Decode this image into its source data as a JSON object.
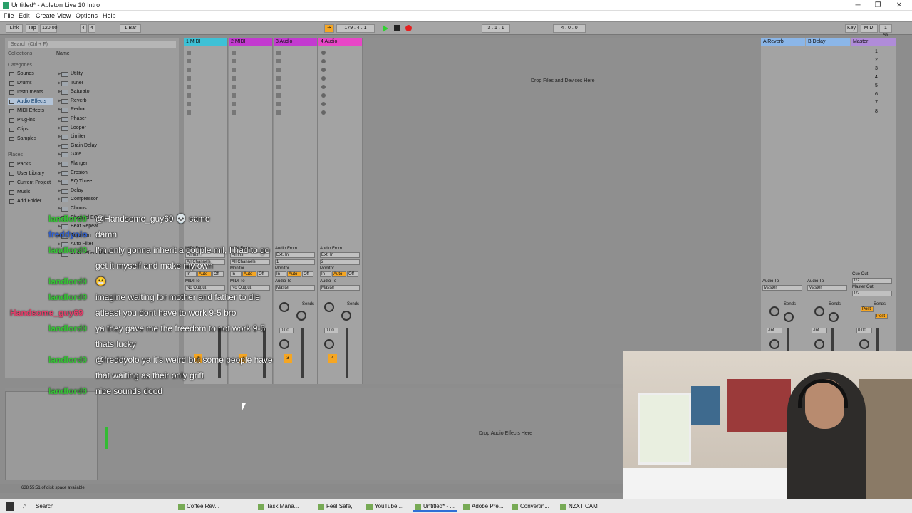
{
  "window": {
    "title": "Untitled* - Ableton Live 10 Intro",
    "min": "─",
    "max": "❐",
    "close": "✕"
  },
  "menu": [
    "File",
    "Edit",
    "Create",
    "View",
    "Options",
    "Help"
  ],
  "transport": {
    "link": "Link",
    "tap": "Tap",
    "tempo": "120.00",
    "sig_num": "4",
    "sig_den": "4",
    "quant": "1 Bar",
    "position": "179 . 4 . 1",
    "loop_start": "3 . 1 . 1",
    "loop_len": "4 . 0 . 0",
    "key": "Key",
    "midi": "MIDI",
    "cpu": "1 %",
    "play_color": "#2fd12f",
    "rec_color": "#e52020"
  },
  "browser": {
    "search_placeholder": "Search (Ctrl + F)",
    "collections": "Collections",
    "categories_label": "Categories",
    "categories": [
      "Sounds",
      "Drums",
      "Instruments",
      "Audio Effects",
      "MIDI Effects",
      "Plug-ins",
      "Clips",
      "Samples"
    ],
    "selected_category": "Audio Effects",
    "places_label": "Places",
    "places": [
      "Packs",
      "User Library",
      "Current Project",
      "Music",
      "Add Folder..."
    ],
    "name_header": "Name",
    "files": [
      "Utility",
      "Tuner",
      "Saturator",
      "Reverb",
      "Redux",
      "Phaser",
      "Looper",
      "Limiter",
      "Grain Delay",
      "Gate",
      "Flanger",
      "Erosion",
      "EQ Three",
      "Delay",
      "Compressor",
      "Chorus",
      "Channel EQ",
      "Beat Repeat",
      "Auto Pan",
      "Auto Filter",
      "Audio Effect Rack"
    ]
  },
  "tracks": [
    {
      "name": "1 MIDI",
      "color": "#3ec1d6",
      "type": "midi",
      "in_label": "MIDI From",
      "in": "All Ins",
      "ch": "All Channels",
      "out_label": "MIDI To",
      "out": "No Output",
      "num": "1"
    },
    {
      "name": "2 MIDI",
      "color": "#c33ad0",
      "type": "midi",
      "in_label": "MIDI From",
      "in": "All Ins",
      "ch": "All Channels",
      "out_label": "MIDI To",
      "out": "No Output",
      "num": "2"
    },
    {
      "name": "3 Audio",
      "color": "#c33ad0",
      "type": "audio",
      "in_label": "Audio From",
      "in": "Ext. In",
      "ch": "1",
      "out_label": "Audio To",
      "out": "Master",
      "num": "3"
    },
    {
      "name": "4 Audio",
      "color": "#e846c7",
      "type": "audio",
      "in_label": "Audio From",
      "in": "Ext. In",
      "ch": "2",
      "out_label": "Audio To",
      "out": "Master",
      "num": "4"
    }
  ],
  "monitor": {
    "label": "Monitor",
    "in": "In",
    "auto": "Auto",
    "off": "Off"
  },
  "sends_label": "Sends",
  "vol_db": "0.00",
  "session_drop": "Drop Files and Devices Here",
  "returns": [
    {
      "name": "A Reverb",
      "color": "#8bb6e8"
    },
    {
      "name": "B Delay",
      "color": "#8bb6e8"
    },
    {
      "name": "Master",
      "color": "#b08cd9"
    }
  ],
  "return_out_label": "Audio To",
  "return_out": "Master",
  "cue_out_label": "Cue Out",
  "cue_out": "1/2",
  "master_out_label": "Master Out",
  "master_out": "1/2",
  "post_label": "Post",
  "return_db": "-Inf",
  "scenes": [
    "1",
    "2",
    "3",
    "4",
    "5",
    "6",
    "7",
    "8"
  ],
  "detail_drop": "Drop Audio Effects Here",
  "status": "638:55:51 of disk space available.",
  "chat": [
    {
      "user": "landlord0",
      "color": "#36c236",
      "msg": "@Handsome_guy69 💀 same"
    },
    {
      "user": "freddyolo",
      "color": "#2e5fd1",
      "msg": "damn"
    },
    {
      "user": "landlord0",
      "color": "#36c236",
      "msg": "I'm only gonna inherit a couple mil, I had to go"
    },
    {
      "user": "",
      "color": "#36c236",
      "msg": "get it myself and make my own"
    },
    {
      "user": "landlord0",
      "color": "#36c236",
      "msg": "😬"
    },
    {
      "user": "landlord0",
      "color": "#36c236",
      "msg": "imagine waiting for mother and father to die"
    },
    {
      "user": "Handsome_guy69",
      "color": "#e0406a",
      "msg": "atleast you dont have to work 9-5 bro"
    },
    {
      "user": "landlord0",
      "color": "#36c236",
      "msg": "ya they gave me the freedom to not work 9-5"
    },
    {
      "user": "",
      "color": "#36c236",
      "msg": "thats lucky"
    },
    {
      "user": "landlord0",
      "color": "#36c236",
      "msg": "@freddyolo ya it's weird but some people have"
    },
    {
      "user": "",
      "color": "#36c236",
      "msg": "that waiting as their only grift"
    },
    {
      "user": "landlord0",
      "color": "#36c236",
      "msg": "nice sounds dood"
    }
  ],
  "taskbar": {
    "search": "Search",
    "items": [
      "Coffee Rev...",
      "Task Mana...",
      "Feel Safe, L...",
      "YouTube ...",
      "Untitled* - ...",
      "Adobe Pre...",
      "Convertin...",
      "NZXT CAM"
    ],
    "active": "Untitled* - ..."
  }
}
